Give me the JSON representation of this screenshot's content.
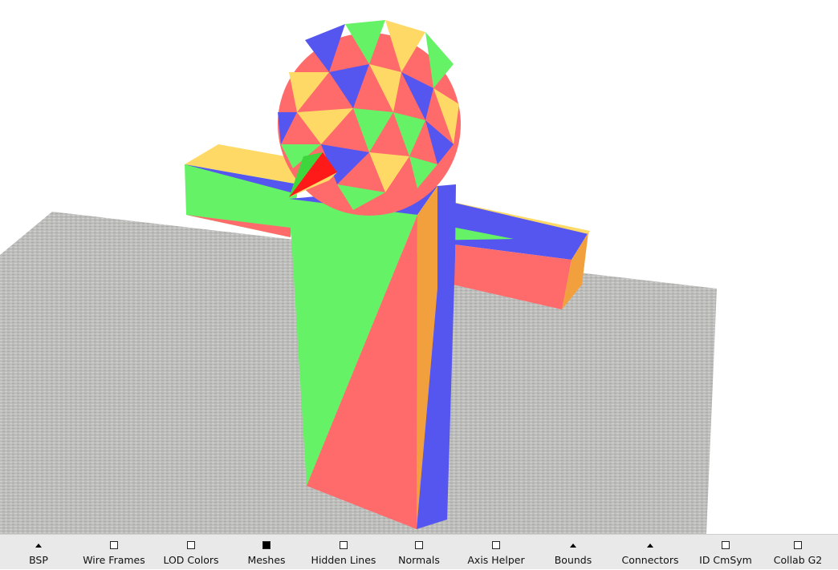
{
  "viewport": {
    "scene": "3d-mesh-figure",
    "colors": {
      "background": "#ffffff",
      "floor": "#bdbdbb",
      "face_green": "#66f266",
      "face_red": "#ff6b6b",
      "face_blue": "#5555ef",
      "face_yellow": "#ffd966",
      "face_orange": "#f2a03d"
    }
  },
  "toolbar": {
    "toggles": [
      {
        "label": "BSP",
        "indicator": "triangle"
      },
      {
        "label": "Wire Frames",
        "indicator": "checkbox"
      },
      {
        "label": "LOD Colors",
        "indicator": "checkbox"
      },
      {
        "label": "Meshes",
        "indicator": "checkbox-filled"
      },
      {
        "label": "Hidden Lines",
        "indicator": "checkbox"
      },
      {
        "label": "Normals",
        "indicator": "checkbox"
      },
      {
        "label": "Axis Helper",
        "indicator": "checkbox"
      },
      {
        "label": "Bounds",
        "indicator": "triangle"
      },
      {
        "label": "Connectors",
        "indicator": "triangle"
      },
      {
        "label": "ID CmSym",
        "indicator": "checkbox"
      },
      {
        "label": "Collab G2",
        "indicator": "checkbox"
      }
    ]
  }
}
